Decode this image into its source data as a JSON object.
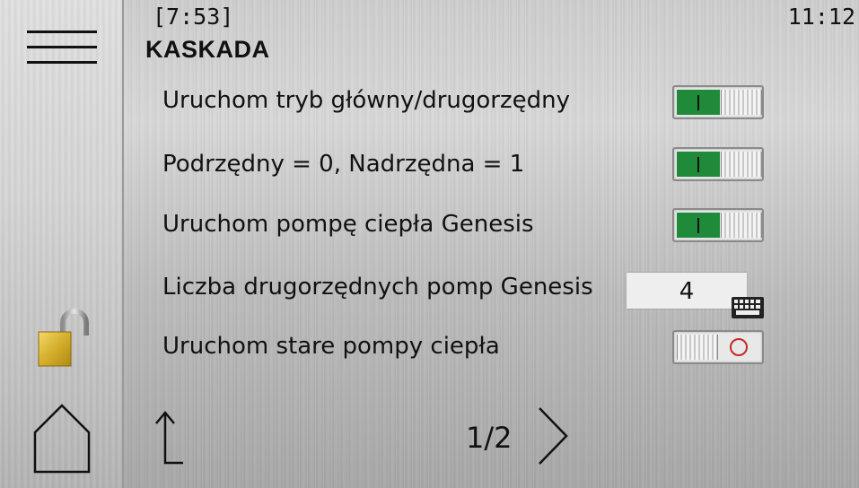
{
  "header": {
    "elapsed": "[7:53]",
    "clock": "11:12",
    "title": "KASKADA"
  },
  "settings": [
    {
      "label": "Uruchom tryb główny/drugorzędny",
      "state": "on"
    },
    {
      "label": "Podrzędny = 0, Nadrzędna = 1",
      "state": "on"
    },
    {
      "label": "Uruchom pompę ciepła Genesis",
      "state": "on"
    },
    {
      "label": "Liczba drugorzędnych pomp Genesis",
      "value": "4"
    },
    {
      "label": "Uruchom stare pompy ciepła",
      "state": "off"
    }
  ],
  "footer": {
    "page": "1/2"
  },
  "icons": [
    "menu-icon",
    "unlocked-padlock-icon",
    "home-icon",
    "keyboard-icon",
    "back-arrow-icon",
    "chevron-right-icon"
  ],
  "colors": {
    "toggle_on": "#1f8a3a",
    "toggle_off_ring": "#c62828",
    "lock_body": "#d9b53a"
  }
}
